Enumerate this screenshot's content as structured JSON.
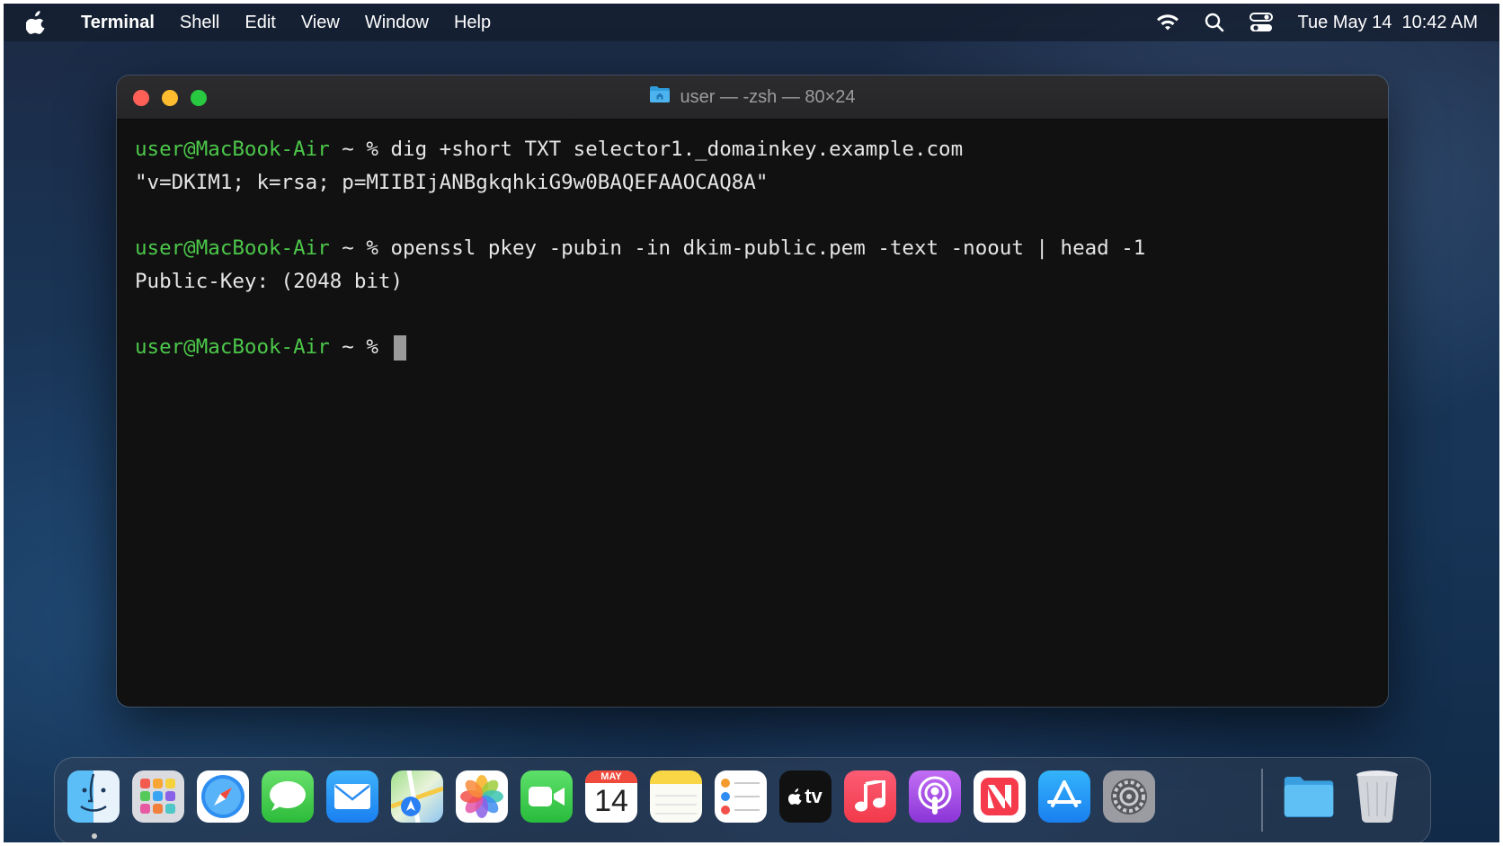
{
  "menubar": {
    "app_name": "Terminal",
    "items": [
      "Shell",
      "Edit",
      "View",
      "Window",
      "Help"
    ],
    "datetime": "Tue May 14  10:42 AM"
  },
  "window": {
    "title": "user — -zsh — 80×24"
  },
  "terminal": {
    "prompt_user": "user@MacBook-Air",
    "prompt_rest": " ~ % ",
    "commands": [
      "dig +short TXT selector1._domainkey.example.com",
      "openssl pkey -pubin -in dkim-public.pem -text -noout | head -1"
    ],
    "outputs": [
      "\"v=DKIM1; k=rsa; p=MIIBIjANBgkqhkiG9w0BAQEFAAOCAQ8A\"",
      "Public-Key: (2048 bit)"
    ],
    "final_prompt_rest": " ~ % "
  },
  "dock": {
    "apps": [
      {
        "name": "finder-icon"
      },
      {
        "name": "launchpad-icon"
      },
      {
        "name": "safari-icon"
      },
      {
        "name": "messages-icon"
      },
      {
        "name": "mail-icon"
      },
      {
        "name": "maps-icon"
      },
      {
        "name": "photos-icon"
      },
      {
        "name": "facetime-icon"
      },
      {
        "name": "calendar-icon",
        "month": "MAY",
        "day": "14"
      },
      {
        "name": "notes-icon"
      },
      {
        "name": "reminders-icon"
      },
      {
        "name": "tv-icon",
        "label": "tv"
      },
      {
        "name": "music-icon"
      },
      {
        "name": "podcasts-icon"
      },
      {
        "name": "news-icon"
      },
      {
        "name": "app-store-icon"
      },
      {
        "name": "system-preferences-icon"
      },
      {
        "name": "downloads-folder-icon"
      },
      {
        "name": "trash-icon"
      }
    ]
  }
}
